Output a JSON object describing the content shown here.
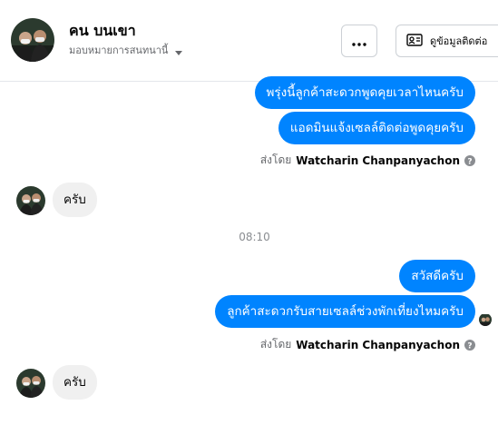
{
  "header": {
    "contact_name": "คน บนเขา",
    "assignee": "มอบหมายการสนทนานี้",
    "more_icon": "ellipsis-icon",
    "contact_button_label": "ดูข้อมูลติดต่อ",
    "contact_button_icon": "id-card-icon"
  },
  "messages": {
    "out_1": "พรุ่งนี้ลูกค้าสะดวกพูดคุยเวลาไหนครับ",
    "out_2": "แอดมินแจ้งเซลล์ติดต่อพูดคุยครับ",
    "sent_by_1": {
      "prefix": "ส่งโดย",
      "name": "Watcharin Chanpanyachon"
    },
    "in_1": "ครับ",
    "timestamp": "08:10",
    "out_3": "สวัสดีครับ",
    "out_4": "ลูกค้าสะดวกรับสายเซลล์ช่วงพักเที่ยงไหมครับ",
    "sent_by_2": {
      "prefix": "ส่งโดย",
      "name": "Watcharin Chanpanyachon"
    },
    "in_2": "ครับ"
  },
  "colors": {
    "outgoing_bubble": "#0084ff",
    "incoming_bubble": "#f0f0f0",
    "muted_text": "#65676b"
  }
}
